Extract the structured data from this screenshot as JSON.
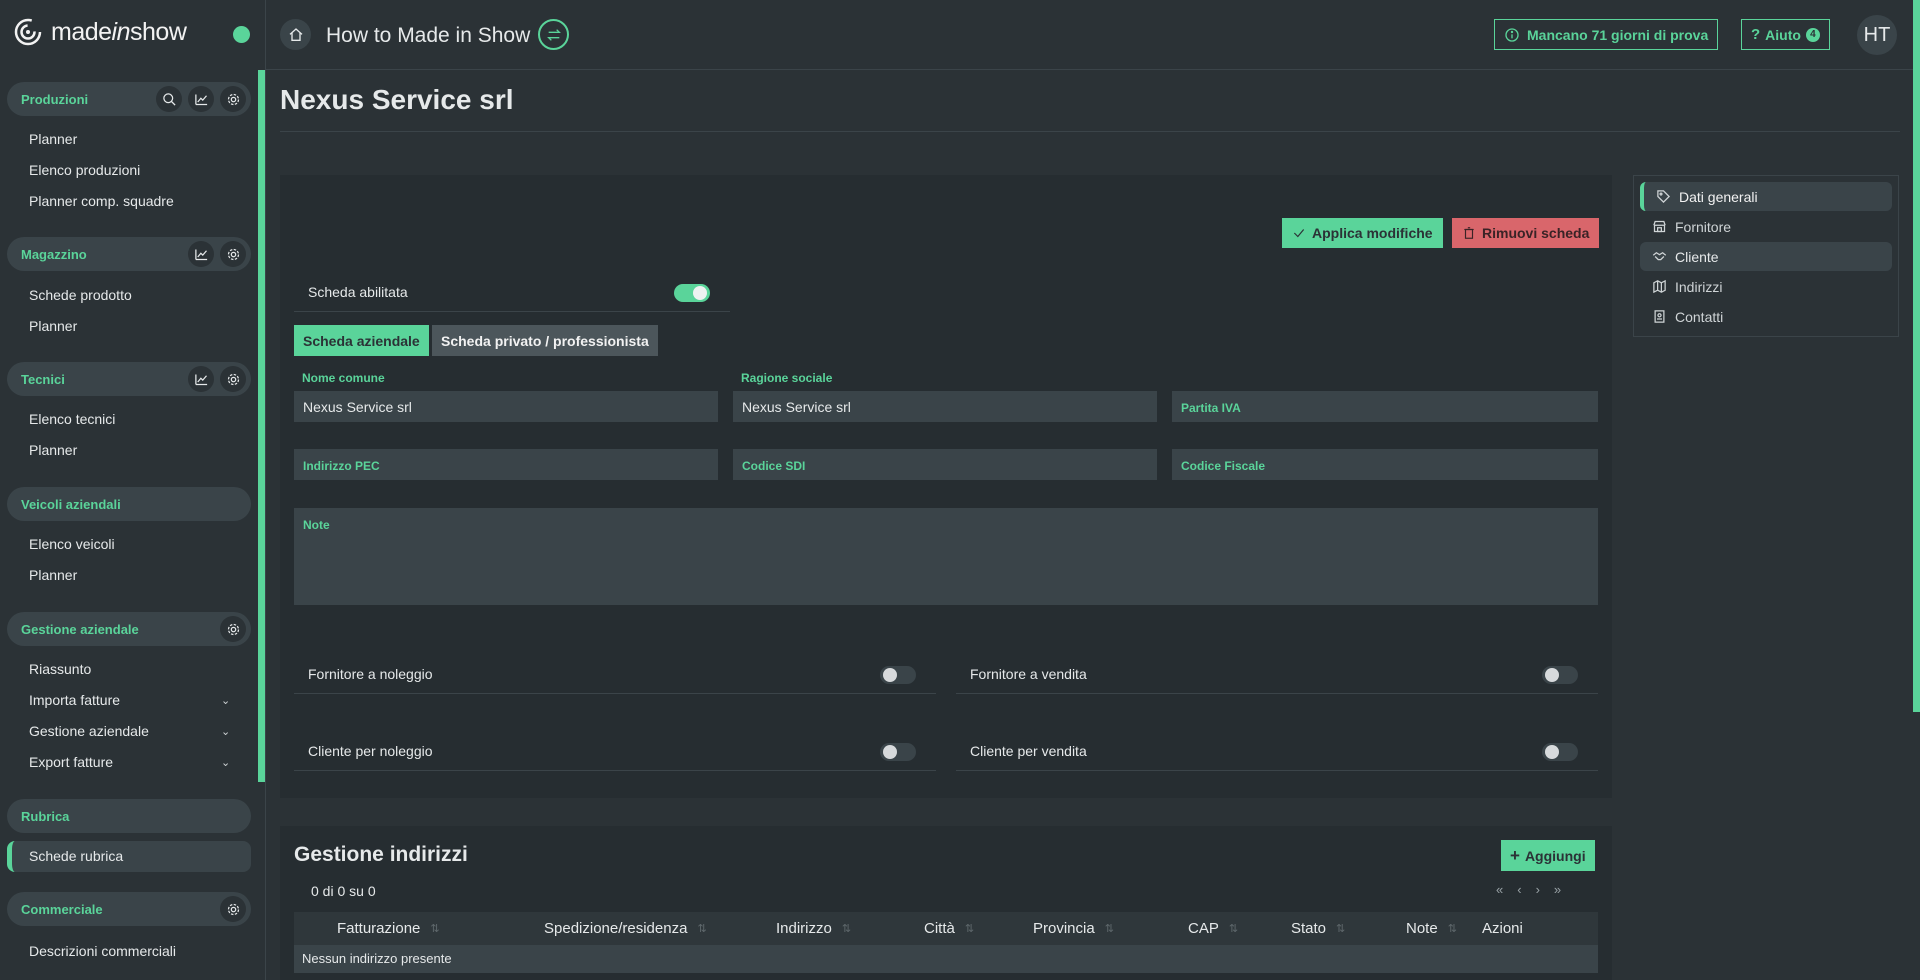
{
  "brand": {
    "logo_prefix": "made",
    "logo_italic": "in",
    "logo_suffix": "show",
    "accent": "#5ad49a"
  },
  "topbar": {
    "title": "How to Made in Show",
    "trial_label": "Mancano 71 giorni di prova",
    "help_label": "Aiuto",
    "help_count": "4",
    "avatar": "HT"
  },
  "sidebar": {
    "groups": [
      {
        "label": "Produzioni",
        "items": [
          "Planner",
          "Elenco produzioni",
          "Planner comp. squadre"
        ]
      },
      {
        "label": "Magazzino",
        "items": [
          "Schede prodotto",
          "Planner"
        ]
      },
      {
        "label": "Tecnici",
        "items": [
          "Elenco tecnici",
          "Planner"
        ]
      },
      {
        "label": "Veicoli aziendali",
        "items": [
          "Elenco veicoli",
          "Planner"
        ]
      },
      {
        "label": "Gestione aziendale",
        "items": [
          "Riassunto",
          "Importa fatture",
          "Gestione aziendale",
          "Export fatture"
        ]
      },
      {
        "label": "Rubrica",
        "items": [
          "Schede rubrica"
        ]
      },
      {
        "label": "Commerciale",
        "items": [
          "Descrizioni commerciali"
        ]
      }
    ]
  },
  "main": {
    "title": "Nexus Service srl",
    "apply_label": "Applica modifiche",
    "remove_label": "Rimuovi scheda",
    "enabled_label": "Scheda abilitata",
    "enabled": true,
    "tabs": [
      "Scheda aziendale",
      "Scheda privato / professionista"
    ],
    "fields": {
      "nome_comune": {
        "label": "Nome comune",
        "value": "Nexus Service srl"
      },
      "ragione_sociale": {
        "label": "Ragione sociale",
        "value": "Nexus Service srl"
      },
      "partita_iva": {
        "label": "Partita IVA",
        "value": ""
      },
      "pec": {
        "label": "Indirizzo PEC",
        "value": ""
      },
      "sdi": {
        "label": "Codice SDI",
        "value": ""
      },
      "cf": {
        "label": "Codice Fiscale",
        "value": ""
      },
      "note": {
        "label": "Note",
        "value": ""
      }
    },
    "toggles": [
      {
        "label": "Fornitore a noleggio",
        "on": false
      },
      {
        "label": "Fornitore a vendita",
        "on": false
      },
      {
        "label": "Cliente per noleggio",
        "on": false
      },
      {
        "label": "Cliente per vendita",
        "on": false
      }
    ]
  },
  "sidenav": {
    "items": [
      {
        "label": "Dati generali",
        "icon": "tag-icon"
      },
      {
        "label": "Fornitore",
        "icon": "store-icon"
      },
      {
        "label": "Cliente",
        "icon": "handshake-icon"
      },
      {
        "label": "Indirizzi",
        "icon": "map-icon"
      },
      {
        "label": "Contatti",
        "icon": "contact-icon"
      }
    ]
  },
  "addresses": {
    "title": "Gestione indirizzi",
    "add_label": "Aggiungi",
    "count": "0 di 0 su 0",
    "columns": [
      "Fatturazione",
      "Spedizione/residenza",
      "Indirizzo",
      "Città",
      "Provincia",
      "CAP",
      "Stato",
      "Note",
      "Azioni"
    ],
    "empty": "Nessun indirizzo presente"
  }
}
